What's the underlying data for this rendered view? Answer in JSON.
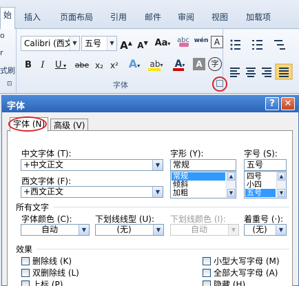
{
  "ribbon": {
    "tabs": [
      {
        "label": "始",
        "active": true
      },
      {
        "label": "插入"
      },
      {
        "label": "页面布局"
      },
      {
        "label": "引用"
      },
      {
        "label": "邮件"
      },
      {
        "label": "审阅"
      },
      {
        "label": "视图"
      },
      {
        "label": "加载项"
      }
    ],
    "left_strip": [
      "o",
      "r",
      "式刷",
      "⊡"
    ],
    "font_name": "Calibri (西文",
    "font_size": "五号",
    "grow_font": "A",
    "shrink_font": "A",
    "change_case": "Aa",
    "clear_formatting_text": "abc",
    "phonetic_guide_text": "wén",
    "char_border": "A",
    "bold": "B",
    "italic": "I",
    "underline": "U",
    "strikethrough": "abe",
    "subscript": "x₂",
    "superscript": "x²",
    "text_effects": "A",
    "highlight": "ab",
    "font_color": "A",
    "char_shading": "A",
    "enclose_char": "字",
    "group_label": "字体",
    "colors": {
      "highlight": "#ffe600",
      "font_color": "#d60000",
      "red_mark": "#d6242b"
    }
  },
  "dialog": {
    "title": "字体",
    "help_button": "?",
    "close_button": "✕",
    "tabs": [
      {
        "label": "字体 (N)",
        "active": true
      },
      {
        "label": "高级 (V)"
      }
    ],
    "chinese_font_label": "中文字体 (T):",
    "chinese_font_value": "+中文正文",
    "western_font_label": "西文字体 (F):",
    "western_font_value": "+西文正文",
    "style_label": "字形 (Y):",
    "style_value": "常规",
    "style_options": [
      "常规",
      "倾斜",
      "加粗"
    ],
    "style_selected": "常规",
    "size_label": "字号 (S):",
    "size_value": "五号",
    "size_options": [
      "四号",
      "小四",
      "五号"
    ],
    "size_selected": "五号",
    "all_text_heading": "所有文字",
    "font_color_label": "字体颜色 (C):",
    "font_color_value": "自动",
    "underline_type_label": "下划线线型 (U):",
    "underline_type_value": "(无)",
    "underline_color_label": "下划线颜色 (I):",
    "underline_color_value": "自动",
    "emphasis_label": "着重号 (·):",
    "emphasis_value": "(无)",
    "effects_heading": "效果",
    "effects": {
      "strikethrough": "删除线 (K)",
      "double_strikethrough": "双删除线 (L)",
      "superscript": "上标 (P)",
      "small_caps": "小型大写字母 (M)",
      "all_caps": "全部大写字母 (A)",
      "hidden": "隐藏 (H)"
    }
  }
}
